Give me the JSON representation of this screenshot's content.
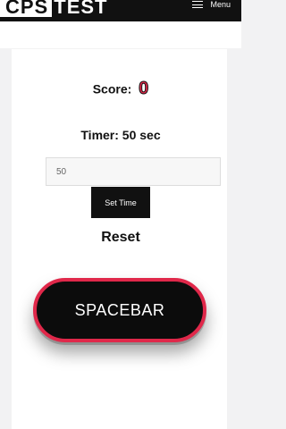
{
  "header": {
    "logo_boxed": "CPS",
    "logo_text": "TEST",
    "menu_label": "Menu"
  },
  "score": {
    "label": "Score:",
    "value": "0"
  },
  "timer": {
    "label": "Timer: 50 sec"
  },
  "time_input": {
    "value": "50"
  },
  "buttons": {
    "set_time": "Set Time",
    "reset": "Reset",
    "spacebar": "SPACEBAR"
  },
  "colors": {
    "accent": "#e0284a",
    "dark": "#111111",
    "background": "#f2f2f3"
  },
  "icons": {
    "menu": "hamburger-icon"
  }
}
